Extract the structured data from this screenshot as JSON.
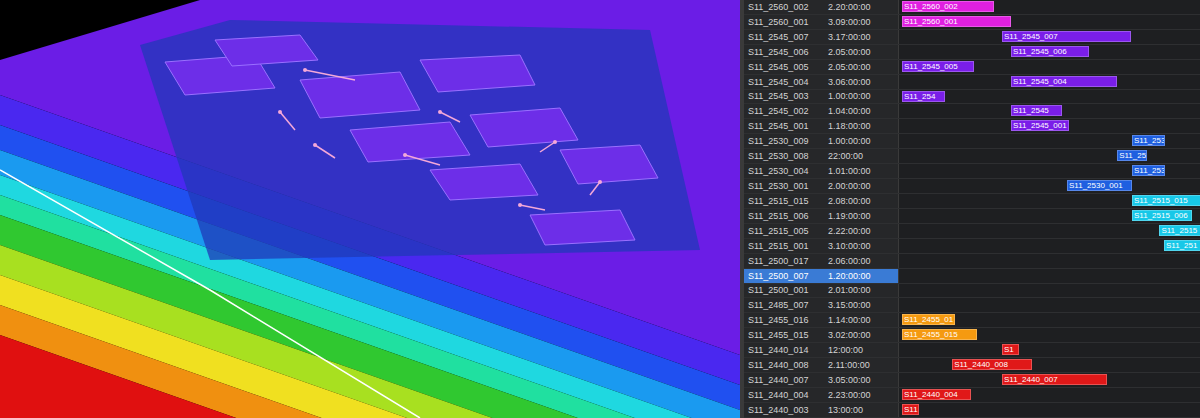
{
  "view": {
    "layers": [
      {
        "color": "#6b1de6"
      },
      {
        "color": "#4a28f0"
      },
      {
        "color": "#2050f0"
      },
      {
        "color": "#1a9af0"
      },
      {
        "color": "#1fd8e0"
      },
      {
        "color": "#20e0a0"
      },
      {
        "color": "#30c830"
      },
      {
        "color": "#a8e020"
      },
      {
        "color": "#f0e020"
      },
      {
        "color": "#f09010"
      },
      {
        "color": "#e01010"
      }
    ]
  },
  "schedule": {
    "rows": [
      {
        "name": "S11_2560_002",
        "duration": "2.20:00:00",
        "selected": false,
        "bar": {
          "label": "S11_2560_002",
          "start": 0,
          "length": 2.79,
          "color": "#e020e0"
        }
      },
      {
        "name": "S11_2560_001",
        "duration": "3.09:00:00",
        "selected": false,
        "bar": {
          "label": "S11_2560_001",
          "start": 0,
          "length": 3.3,
          "color": "#e020e0"
        }
      },
      {
        "name": "S11_2545_007",
        "duration": "3.17:00:00",
        "selected": false,
        "bar": {
          "label": "S11_2545_007",
          "start": 3.03,
          "length": 3.91,
          "color": "#7a1ee8"
        }
      },
      {
        "name": "S11_2545_006",
        "duration": "2.05:00:00",
        "selected": false,
        "bar": {
          "label": "S11_2545_006",
          "start": 3.3,
          "length": 2.36,
          "color": "#7a1ee8"
        }
      },
      {
        "name": "S11_2545_005",
        "duration": "2.05:00:00",
        "selected": false,
        "bar": {
          "label": "S11_2545_005",
          "start": 0,
          "length": 2.18,
          "color": "#7a1ee8"
        }
      },
      {
        "name": "S11_2545_004",
        "duration": "3.06:00:00",
        "selected": false,
        "bar": {
          "label": "S11_2545_004",
          "start": 3.3,
          "length": 3.21,
          "color": "#7a1ee8"
        }
      },
      {
        "name": "S11_2545_003",
        "duration": "1.00:00:00",
        "selected": false,
        "bar": {
          "label": "S11_254",
          "start": 0,
          "length": 1.3,
          "color": "#7a1ee8"
        }
      },
      {
        "name": "S11_2545_002",
        "duration": "1.04:00:00",
        "selected": false,
        "bar": {
          "label": "S11_2545",
          "start": 3.3,
          "length": 1.55,
          "color": "#7a1ee8"
        }
      },
      {
        "name": "S11_2545_001",
        "duration": "1.18:00:00",
        "selected": false,
        "bar": {
          "label": "S11_2545_001",
          "start": 3.3,
          "length": 1.75,
          "color": "#7a1ee8"
        }
      },
      {
        "name": "S11_2530_009",
        "duration": "1.00:00:00",
        "selected": false,
        "bar": {
          "label": "S11_253",
          "start": 6.97,
          "length": 1.0,
          "color": "#1f5fe0"
        }
      },
      {
        "name": "S11_2530_008",
        "duration": "22:00:00",
        "selected": false,
        "bar": {
          "label": "S11_25",
          "start": 6.52,
          "length": 0.9,
          "color": "#1f5fe0"
        }
      },
      {
        "name": "S11_2530_004",
        "duration": "1.01:00:00",
        "selected": false,
        "bar": {
          "label": "S11_253",
          "start": 6.97,
          "length": 1.0,
          "color": "#1f5fe0"
        }
      },
      {
        "name": "S11_2530_001",
        "duration": "2.00:00:00",
        "selected": false,
        "bar": {
          "label": "S11_2530_001",
          "start": 5,
          "length": 1.97,
          "color": "#1f5fe0"
        }
      },
      {
        "name": "S11_2515_015",
        "duration": "2.08:00:00",
        "selected": false,
        "bar": {
          "label": "S11_2515_015",
          "start": 6.97,
          "length": 2.2,
          "color": "#17c8e8"
        }
      },
      {
        "name": "S11_2515_006",
        "duration": "1.19:00:00",
        "selected": false,
        "bar": {
          "label": "S11_2515_006",
          "start": 6.97,
          "length": 1.82,
          "color": "#17c8e8"
        }
      },
      {
        "name": "S11_2515_005",
        "duration": "2.22:00:00",
        "selected": false,
        "bar": {
          "label": "S11_2515",
          "start": 7.8,
          "length": 1.4,
          "color": "#17c8e8"
        }
      },
      {
        "name": "S11_2515_001",
        "duration": "3.10:00:00",
        "selected": false,
        "bar": {
          "label": "S11_251",
          "start": 7.94,
          "length": 1.3,
          "color": "#17c8e8"
        }
      },
      {
        "name": "S11_2500_017",
        "duration": "2.06:00:00",
        "selected": false,
        "bar": null
      },
      {
        "name": "S11_2500_007",
        "duration": "1.20:00:00",
        "selected": true,
        "bar": null
      },
      {
        "name": "S11_2500_001",
        "duration": "2.01:00:00",
        "selected": false,
        "bar": null
      },
      {
        "name": "S11_2485_007",
        "duration": "3.15:00:00",
        "selected": false,
        "bar": null
      },
      {
        "name": "S11_2455_016",
        "duration": "1.14:00:00",
        "selected": false,
        "bar": {
          "label": "S11_2455_01",
          "start": 0,
          "length": 1.62,
          "color": "#f59a10"
        }
      },
      {
        "name": "S11_2455_015",
        "duration": "3.02:00:00",
        "selected": false,
        "bar": {
          "label": "S11_2455_015",
          "start": 0,
          "length": 2.27,
          "color": "#f59a10"
        }
      },
      {
        "name": "S11_2440_014",
        "duration": "12:00:00",
        "selected": false,
        "bar": {
          "label": "S1",
          "start": 3.03,
          "length": 0.52,
          "color": "#e01818"
        }
      },
      {
        "name": "S11_2440_008",
        "duration": "2.11:00:00",
        "selected": false,
        "bar": {
          "label": "S11_2440_008",
          "start": 1.52,
          "length": 2.42,
          "color": "#e01818"
        }
      },
      {
        "name": "S11_2440_007",
        "duration": "3.05:00:00",
        "selected": false,
        "bar": {
          "label": "S11_2440_007",
          "start": 3.03,
          "length": 3.18,
          "color": "#e01818"
        }
      },
      {
        "name": "S11_2440_004",
        "duration": "2.23:00:00",
        "selected": false,
        "bar": {
          "label": "S11_2440_004",
          "start": 0,
          "length": 2.1,
          "color": "#e01818"
        }
      },
      {
        "name": "S11_2440_003",
        "duration": "13:00:00",
        "selected": false,
        "bar": {
          "label": "S11",
          "start": 0,
          "length": 0.5,
          "color": "#e01818"
        }
      }
    ]
  }
}
